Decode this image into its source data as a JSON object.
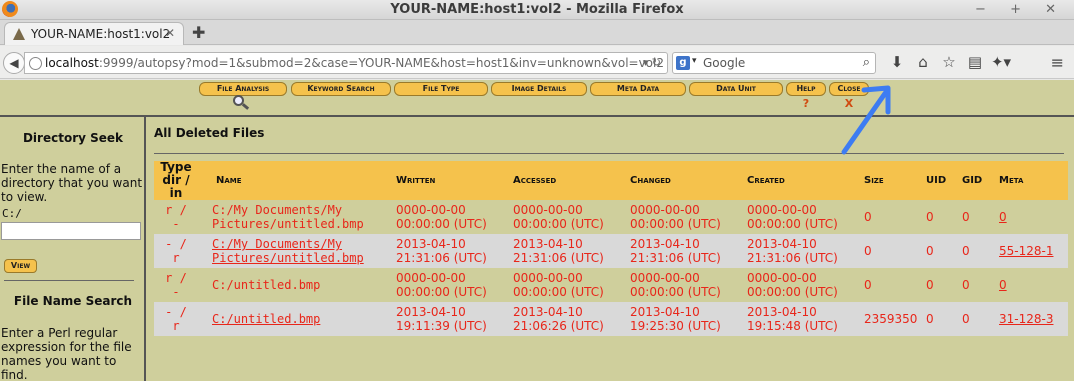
{
  "window": {
    "title": "YOUR-NAME:host1:vol2 - Mozilla Firefox",
    "controls": "− + ✕"
  },
  "tabs": [
    {
      "label": "YOUR-NAME:host1:vol2"
    }
  ],
  "navbar": {
    "url_host": "localhost",
    "url_rest": ":9999/autopsy?mod=1&submod=2&case=YOUR-NAME&host=host1&inv=unknown&vol=vol2",
    "search_placeholder": "Google"
  },
  "toolbar": {
    "buttons": [
      "File Analysis",
      "Keyword Search",
      "File Type",
      "Image Details",
      "Meta Data",
      "Data Unit",
      "Help",
      "Close"
    ],
    "help_icon": "?",
    "close_icon": "X"
  },
  "left": {
    "dir_heading": "Directory Seek",
    "dir_text": "Enter the name of a directory that you want to view.",
    "dir_default": "C:/",
    "view_label": "View",
    "fn_heading": "File Name Search",
    "fn_text": "Enter a Perl regular expression for the file names you want to find."
  },
  "main": {
    "title": "All Deleted Files",
    "columns": [
      "Type dir / in",
      "Name",
      "Written",
      "Accessed",
      "Changed",
      "Created",
      "Size",
      "UID",
      "GID",
      "Meta"
    ],
    "rows": [
      {
        "type": "r / -",
        "name": "C:/My Documents/My Pictures/untitled.bmp",
        "name_link": false,
        "written": "0000-00-00 00:00:00 (UTC)",
        "accessed": "0000-00-00 00:00:00 (UTC)",
        "changed": "0000-00-00 00:00:00 (UTC)",
        "created": "0000-00-00 00:00:00 (UTC)",
        "size": "0",
        "uid": "0",
        "gid": "0",
        "meta": "0"
      },
      {
        "type": "- / r",
        "name": "C:/My Documents/My Pictures/untitled.bmp",
        "name_link": true,
        "written": "2013-04-10 21:31:06 (UTC)",
        "accessed": "2013-04-10 21:31:06 (UTC)",
        "changed": "2013-04-10 21:31:06 (UTC)",
        "created": "2013-04-10 21:31:06 (UTC)",
        "size": "0",
        "uid": "0",
        "gid": "0",
        "meta": "55-128-1"
      },
      {
        "type": "r / -",
        "name": "C:/untitled.bmp",
        "name_link": false,
        "written": "0000-00-00 00:00:00 (UTC)",
        "accessed": "0000-00-00 00:00:00 (UTC)",
        "changed": "0000-00-00 00:00:00 (UTC)",
        "created": "0000-00-00 00:00:00 (UTC)",
        "size": "0",
        "uid": "0",
        "gid": "0",
        "meta": "0"
      },
      {
        "type": "- / r",
        "name": "C:/untitled.bmp",
        "name_link": true,
        "written": "2013-04-10 19:11:39 (UTC)",
        "accessed": "2013-04-10 21:06:26 (UTC)",
        "changed": "2013-04-10 19:25:30 (UTC)",
        "created": "2013-04-10 19:15:48 (UTC)",
        "size": "2359350",
        "uid": "0",
        "gid": "0",
        "meta": "31-128-3"
      }
    ]
  },
  "colors": {
    "accent": "#f5c24c",
    "background": "#cfcf9c",
    "deleted_text": "#e8261a",
    "arrow": "#3d7cf2"
  }
}
